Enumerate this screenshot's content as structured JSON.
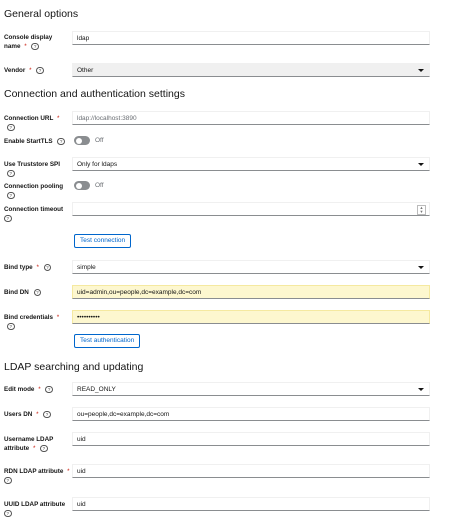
{
  "sections": {
    "general": "General options",
    "connection": "Connection and authentication settings",
    "ldap": "LDAP searching and updating"
  },
  "fields": {
    "console_display_name": {
      "label": "Console display name",
      "value": "ldap"
    },
    "vendor": {
      "label": "Vendor",
      "value": "Other"
    },
    "connection_url": {
      "label": "Connection URL",
      "placeholder": "ldap://localhost:3890"
    },
    "enable_starttls": {
      "label": "Enable StartTLS",
      "state": "Off"
    },
    "use_truststore_spi": {
      "label": "Use Truststore SPI",
      "value": "Only for ldaps"
    },
    "connection_pooling": {
      "label": "Connection pooling",
      "state": "Off"
    },
    "connection_timeout": {
      "label": "Connection timeout",
      "value": ""
    },
    "bind_type": {
      "label": "Bind type",
      "value": "simple"
    },
    "bind_dn": {
      "label": "Bind DN",
      "value": "uid=admin,ou=people,dc=example,dc=com"
    },
    "bind_credentials": {
      "label": "Bind credentials",
      "value": "••••••••••"
    },
    "edit_mode": {
      "label": "Edit mode",
      "value": "READ_ONLY"
    },
    "users_dn": {
      "label": "Users DN",
      "value": "ou=people,dc=example,dc=com"
    },
    "username_ldap_attribute": {
      "label": "Username LDAP attribute",
      "value": "uid"
    },
    "rdn_ldap_attribute": {
      "label": "RDN LDAP attribute",
      "value": "uid"
    },
    "uuid_ldap_attribute": {
      "label": "UUID LDAP attribute",
      "value": "uid"
    }
  },
  "buttons": {
    "test_connection": "Test connection",
    "test_authentication": "Test authentication"
  },
  "icons": {
    "help": "?",
    "required": "*",
    "spinner_up": "▲",
    "spinner_down": "▼"
  },
  "colors": {
    "accent": "#0066cc",
    "required": "#c9190b",
    "autofill": "#fdf7cf"
  }
}
